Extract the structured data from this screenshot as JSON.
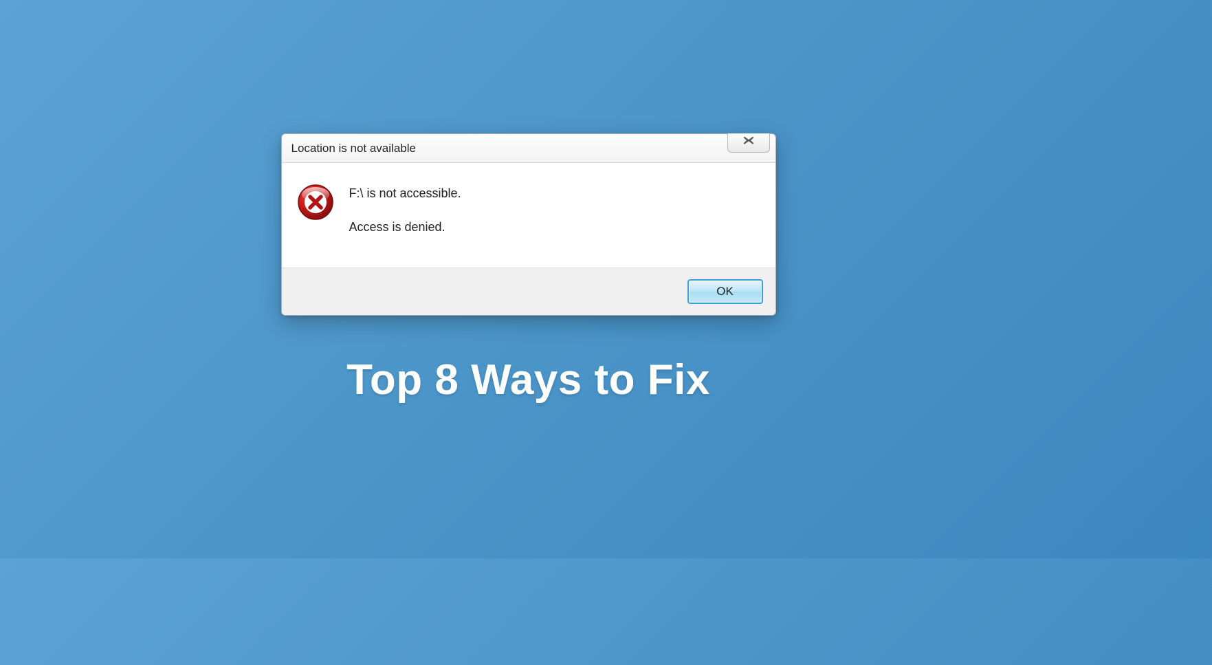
{
  "dialog": {
    "title": "Location is not available",
    "message_line1": "F:\\ is not accessible.",
    "message_line2": "Access is denied.",
    "ok_label": "OK"
  },
  "caption": "Top 8 Ways to Fix"
}
